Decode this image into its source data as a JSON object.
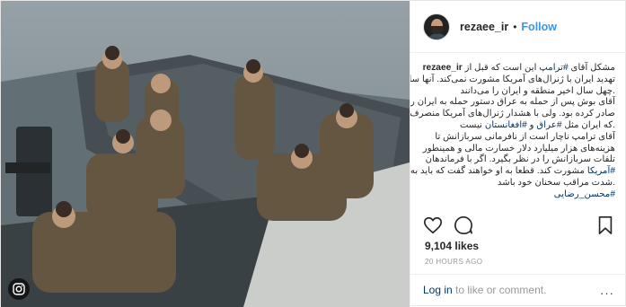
{
  "post": {
    "username": "rezaee_ir",
    "follow_label": "Follow",
    "separator": "•",
    "likes": "9,104 likes",
    "timestamp": "20 HOURS AGO",
    "login_text": "Log in",
    "comment_text": " to like or comment.",
    "more_label": "···"
  },
  "caption": {
    "lines": [
      {
        "prefix": "مشکل آقای ",
        "tag": "#ترامپ",
        "suffix": " این است که قبل از ",
        "user": "rezaee_ir"
      },
      {
        "text": "تهدید ایران با ژنرال‌های آمریکا مشورت نمی‌کند. آنها سابقه"
      },
      {
        "text": ".چهل سال اخیر منطقه و ایران را می‌دانند"
      },
      {
        "text": "آقای بوش پس از حمله به عراق دستور حمله به ایران را"
      },
      {
        "text": "صادر کرده بود. ولی با هشدار ژنرال‌های آمریکا منصرف شد"
      },
      {
        "prefix": ".که ایران مثل ",
        "tag": "#عراق",
        "middle": " و ",
        "tag2": "#افغانستان",
        "suffix": " نیست"
      },
      {
        "text": "آقای ترامپ ناچار است از نافرمانی سربازانش تا"
      },
      {
        "text": "هزینه‌های هزار میلیارد دلار خسارت مالی و همینطور"
      },
      {
        "text": "تلفات سربازانش را در نظر بگیرد. اگر با فرماندهان"
      },
      {
        "prefix": "",
        "tag": "#آمریکا",
        "suffix": " مشورت کند. قطعا به او خواهند گفت که باید به"
      },
      {
        "text": ".شدت مراقب سخنان خود باشد"
      },
      {
        "prefix": "",
        "tag": "#محسن_رضایی",
        "suffix": ""
      }
    ]
  },
  "icons": [
    "heart-icon",
    "comment-icon",
    "bookmark-icon",
    "instagram-badge-icon"
  ]
}
